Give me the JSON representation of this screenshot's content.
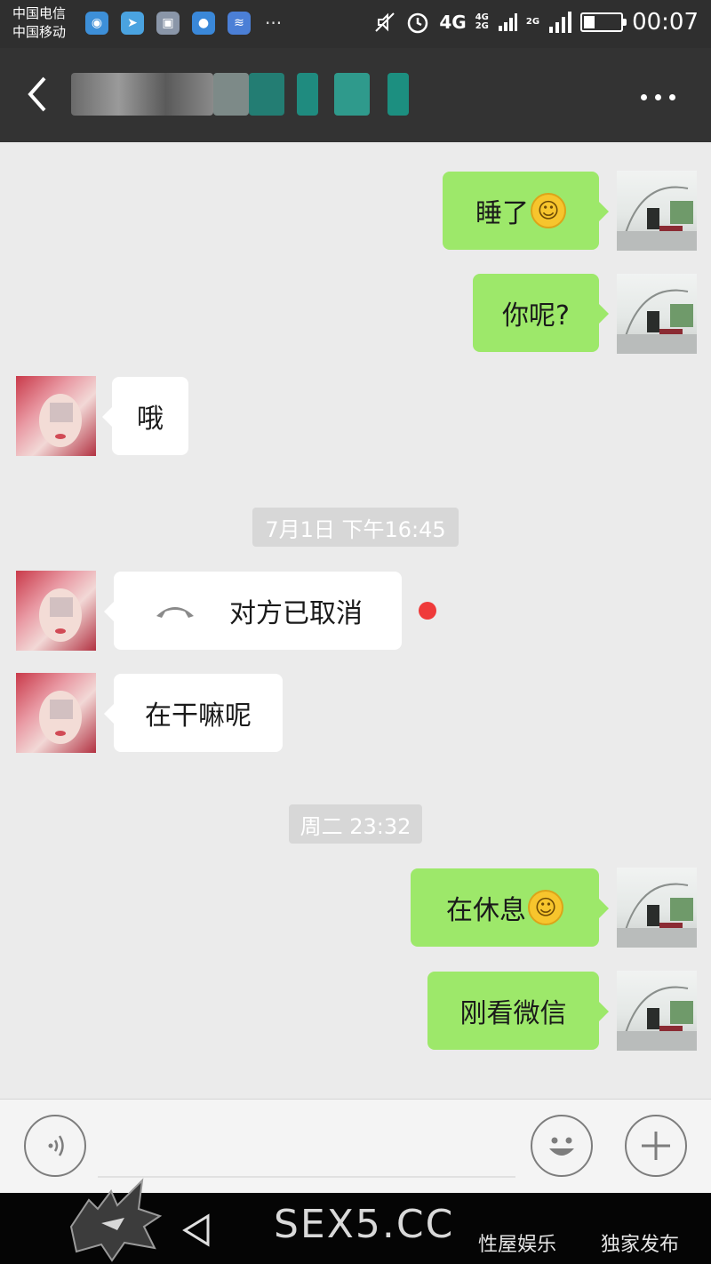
{
  "status_bar": {
    "carrier_1": "中国电信",
    "carrier_2": "中国移动",
    "network": "4G",
    "network_small_top": "4G",
    "network_small_bottom": "2G",
    "network_2g": "2G",
    "time": "00:07",
    "battery_level": 0.3,
    "more": "···"
  },
  "title_bar": {
    "name_blurred": true
  },
  "messages": [
    {
      "side": "out",
      "text": "睡了",
      "emoji": "smile-emoji"
    },
    {
      "side": "out",
      "text": "你呢?"
    },
    {
      "side": "in",
      "text": "哦"
    },
    {
      "type": "time",
      "text": "7月1日 下午16:45"
    },
    {
      "side": "in",
      "type": "call",
      "text": "对方已取消",
      "icon": "phone-hangup-icon",
      "unread_dot": true
    },
    {
      "side": "in",
      "text": "在干嘛呢"
    },
    {
      "type": "time",
      "text": "周二 23:32"
    },
    {
      "side": "out",
      "text": "在休息",
      "emoji": "smile-emoji"
    },
    {
      "side": "out",
      "text": "刚看微信"
    }
  ],
  "input_bar": {
    "voice_icon": "voice-icon",
    "emoji_icon": "emoji-icon",
    "add_icon": "plus-icon"
  },
  "watermark": {
    "site": "SEX5.CC",
    "tag_1": "性屋娱乐",
    "tag_2": "独家发布"
  },
  "colors": {
    "outgoing_bubble": "#9de86a",
    "incoming_bubble": "#ffffff",
    "title_bar": "#333333",
    "unread_dot": "#ef3a3a"
  }
}
